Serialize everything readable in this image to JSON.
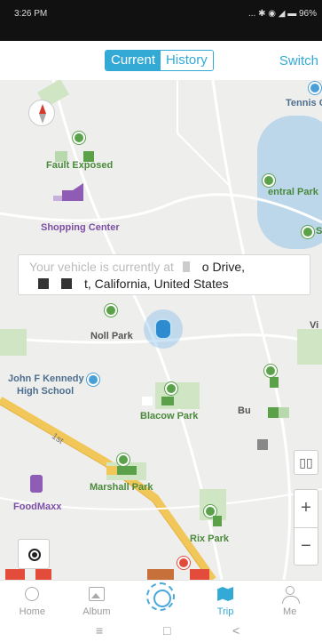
{
  "status_bar": {
    "time": "3:26 PM",
    "icons_text": "... ✱ ◉ ◢ ▬ 96%"
  },
  "header": {
    "tabs": [
      {
        "label": "Current",
        "active": true
      },
      {
        "label": "History",
        "active": false
      }
    ],
    "switch_label": "Switch"
  },
  "map": {
    "labels": {
      "tennis": "Tennis C",
      "fault_exposed": "Fault Exposed",
      "central_park": "entral Park",
      "shopping_center": "Shopping Center",
      "noll_park": "Noll Park",
      "jfk_line1": "John F Kennedy",
      "jfk_line2": "High School",
      "blacow_park": "Blacow Park",
      "bu": "Bu",
      "marshall_park": "Marshall Park",
      "foodmaxx": "FoodMaxx",
      "rix_park": "Rix Park",
      "road_1st": "1st",
      "vi": "Vi",
      "s_edge": "S"
    },
    "callout": {
      "line1_prefix": "Your vehicle is currently at",
      "line1_rest": "o Drive,",
      "line2_rest": "t, California, United States"
    },
    "zoom_in_symbol": "+",
    "zoom_out_symbol": "−",
    "layers_symbol": "▯▯",
    "colors": {
      "accent": "#33a9d6",
      "park_green": "#5aa14a",
      "road_yellow": "#f1c75a"
    }
  },
  "tabbar": [
    {
      "label": "Home",
      "icon": "home-icon",
      "active": false
    },
    {
      "label": "Album",
      "icon": "album-icon",
      "active": false
    },
    {
      "label": "",
      "icon": "record-icon",
      "active": false
    },
    {
      "label": "Trip",
      "icon": "trip-icon",
      "active": true
    },
    {
      "label": "Me",
      "icon": "me-icon",
      "active": false
    }
  ],
  "navbar": {
    "menu": "≡",
    "home": "□",
    "back": "<"
  }
}
